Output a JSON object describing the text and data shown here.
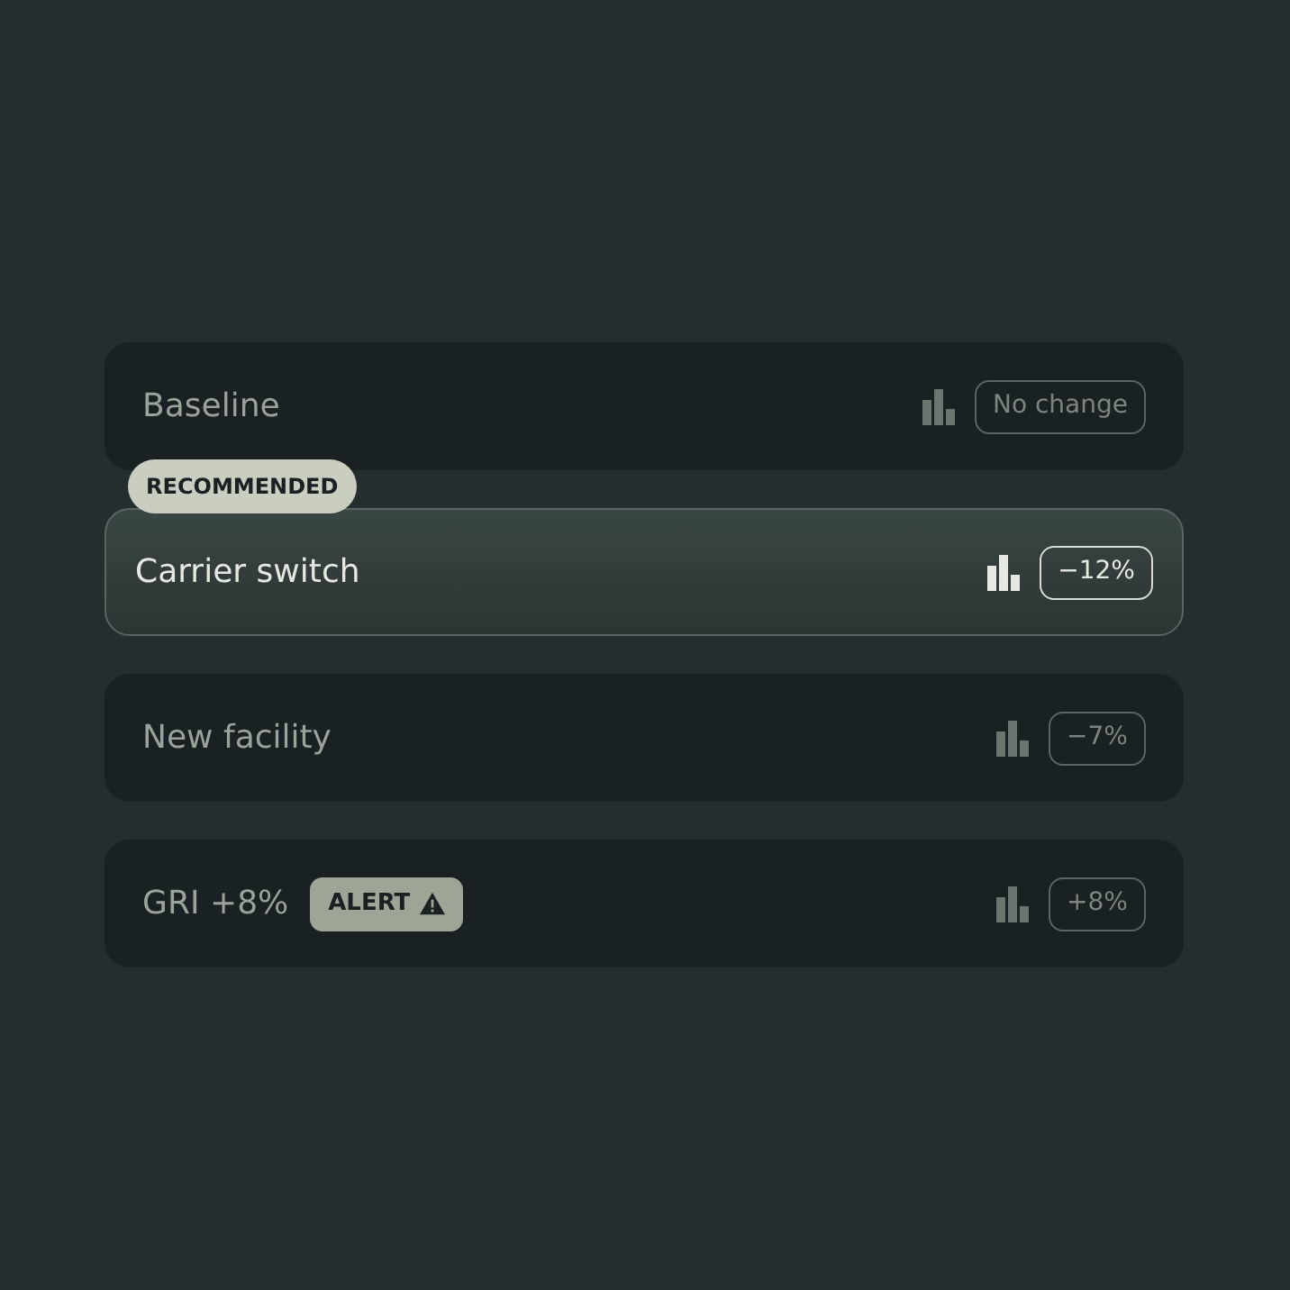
{
  "scenarios": [
    {
      "label": "Baseline",
      "selected": false,
      "change": "No change"
    },
    {
      "label": "Carrier switch",
      "selected": true,
      "badge": "RECOMMENDED",
      "change": "−12%"
    },
    {
      "label": "New facility",
      "selected": false,
      "change": "−7%"
    },
    {
      "label": "GRI +8%",
      "selected": false,
      "alert": "ALERT",
      "change": "+8%"
    }
  ]
}
